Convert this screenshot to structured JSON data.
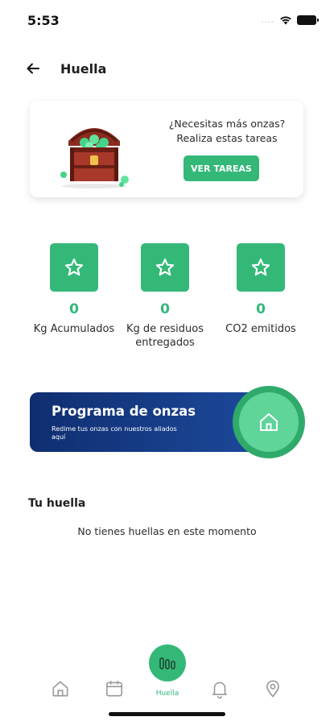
{
  "status_bar": {
    "time": "5:53",
    "signal": "....",
    "wifi_icon": "wifi-icon",
    "battery_icon": "battery-icon"
  },
  "header": {
    "title": "Huella",
    "back_icon": "back-arrow-icon"
  },
  "tasks_card": {
    "line1": "¿Necesitas más onzas?",
    "line2": "Realiza estas tareas",
    "button_label": "VER TAREAS",
    "image": "treasure-chest-illustration"
  },
  "stats": [
    {
      "value": "0",
      "label": "Kg Acumulados",
      "icon": "star-icon"
    },
    {
      "value": "0",
      "label": "Kg de residuos entregados",
      "icon": "star-icon"
    },
    {
      "value": "0",
      "label": "CO2 emitidos",
      "icon": "star-icon"
    }
  ],
  "program": {
    "title": "Programa de onzas",
    "subtitle": "Redime tus onzas con nuestros aliados aquí",
    "icon": "home-icon"
  },
  "footprint": {
    "title": "Tu huella",
    "empty_message": "No tienes huellas en este momento"
  },
  "tabbar": {
    "tabs": [
      {
        "name": "home",
        "icon": "home-icon"
      },
      {
        "name": "calendar",
        "icon": "calendar-icon"
      },
      {
        "name": "huella",
        "icon": "bars-icon",
        "label": "Huella",
        "active": true
      },
      {
        "name": "notifications",
        "icon": "bell-icon"
      },
      {
        "name": "location",
        "icon": "location-pin-icon"
      }
    ]
  },
  "colors": {
    "accent": "#34b878",
    "banner_dark": "#0f2e70",
    "text": "#2c2c2c"
  }
}
